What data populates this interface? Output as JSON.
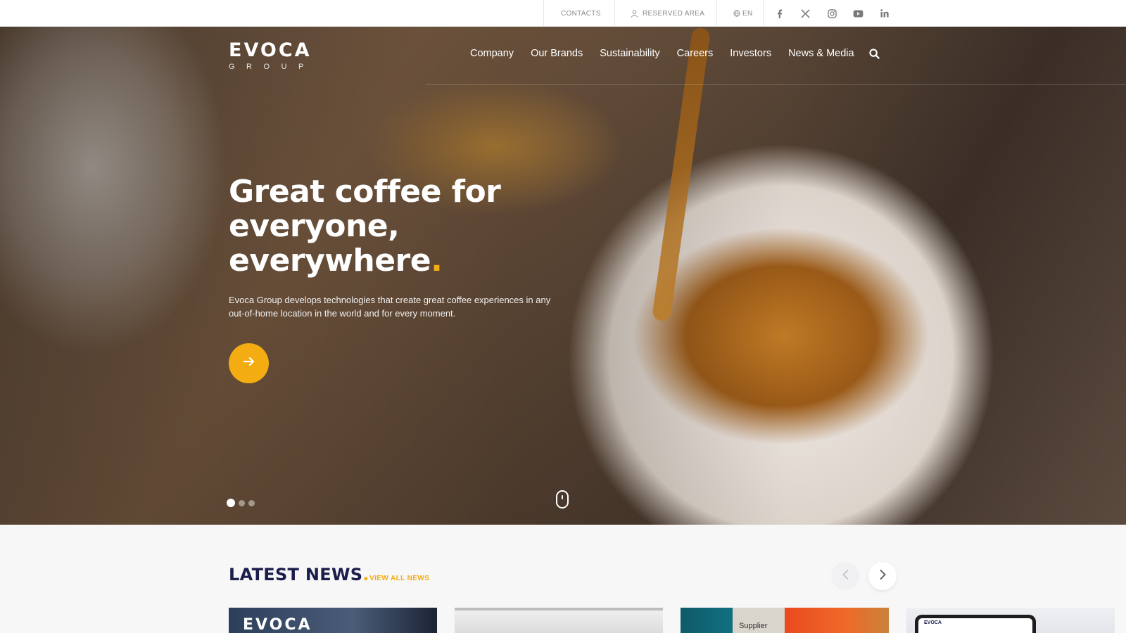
{
  "topbar": {
    "contacts": "CONTACTS",
    "reserved_area": "RESERVED AREA",
    "language": "EN",
    "social": [
      "facebook-icon",
      "x-twitter-icon",
      "instagram-icon",
      "youtube-icon",
      "linkedin-icon"
    ]
  },
  "header": {
    "logo_word": "EVOCA",
    "logo_sub": "GROUP",
    "nav": [
      "Company",
      "Our Brands",
      "Sustainability",
      "Careers",
      "Investors",
      "News & Media"
    ]
  },
  "hero": {
    "headline": "Great coffee for everyone, everywhere",
    "headline_dot": ".",
    "text": "Evoca Group develops technologies that create great coffee experiences in any out-of-home location in the world and for every moment.",
    "slides_total": 3,
    "active_slide": 1
  },
  "news": {
    "title": "LATEST NEWS",
    "title_dot": ".",
    "view_all": "VIEW ALL NEWS",
    "cards": [
      {
        "image_text": "EVOCA"
      },
      {
        "image_text": ""
      },
      {
        "image_text": "Supplier"
      },
      {
        "image_text": "EVOCA"
      }
    ]
  },
  "colors": {
    "accent": "#f3ac12",
    "brand_navy": "#1b1d4a"
  }
}
